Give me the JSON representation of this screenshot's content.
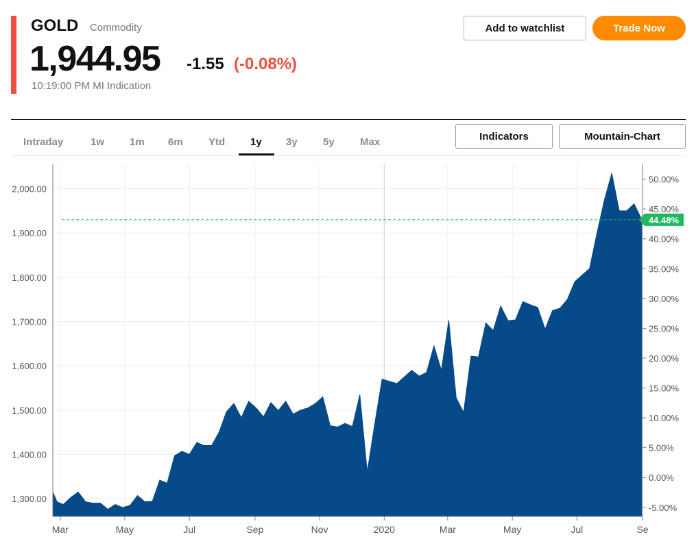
{
  "header": {
    "symbol": "GOLD",
    "asset_type": "Commodity",
    "price": "1,944.95",
    "change": "-1.55",
    "change_pct": "(-0.08%)",
    "timestamp": "10:19:00 PM MI Indication",
    "accent_color": "#f04e3e"
  },
  "actions": {
    "watchlist_label": "Add to watchlist",
    "trade_label": "Trade Now",
    "trade_color": "#ff8a00"
  },
  "tabs": [
    {
      "label": "Intraday",
      "active": false
    },
    {
      "label": "1w",
      "active": false
    },
    {
      "label": "1m",
      "active": false
    },
    {
      "label": "6m",
      "active": false
    },
    {
      "label": "Ytd",
      "active": false
    },
    {
      "label": "1y",
      "active": true
    },
    {
      "label": "3y",
      "active": false
    },
    {
      "label": "5y",
      "active": false
    },
    {
      "label": "Max",
      "active": false
    }
  ],
  "chart_controls": {
    "indicators_label": "Indicators",
    "chart_type_label": "Mountain-Chart"
  },
  "chart_data": {
    "type": "area",
    "fill_color": "#064a8a",
    "reference_color": "#1eb85d",
    "reference_value": 1930,
    "reference_label": "44.48%",
    "ylim": [
      1260,
      2055
    ],
    "y_ticks": [
      {
        "value": 1300,
        "label": "1,300.00"
      },
      {
        "value": 1400,
        "label": "1,400.00"
      },
      {
        "value": 1500,
        "label": "1,500.00"
      },
      {
        "value": 1600,
        "label": "1,600.00"
      },
      {
        "value": 1700,
        "label": "1,700.00"
      },
      {
        "value": 1800,
        "label": "1,800.00"
      },
      {
        "value": 1900,
        "label": "1,900.00"
      },
      {
        "value": 2000,
        "label": "2,000.00"
      }
    ],
    "y2_ticks": [
      {
        "value": 1280.4,
        "label": "-5.00%"
      },
      {
        "value": 1347.8,
        "label": "0.00%"
      },
      {
        "value": 1415.2,
        "label": "5.00%"
      },
      {
        "value": 1482.6,
        "label": "10.00%"
      },
      {
        "value": 1550.0,
        "label": "15.00%"
      },
      {
        "value": 1617.4,
        "label": "20.00%"
      },
      {
        "value": 1684.7,
        "label": "25.00%"
      },
      {
        "value": 1752.1,
        "label": "30.00%"
      },
      {
        "value": 1819.5,
        "label": "35.00%"
      },
      {
        "value": 1886.9,
        "label": "40.00%"
      },
      {
        "value": 1954.3,
        "label": "45.00%"
      },
      {
        "value": 2021.7,
        "label": "50.00%"
      }
    ],
    "x_ticks": [
      {
        "date": "2019-03-01",
        "label": "Mar"
      },
      {
        "date": "2019-05-01",
        "label": "May"
      },
      {
        "date": "2019-07-01",
        "label": "Jul"
      },
      {
        "date": "2019-09-01",
        "label": "Sep"
      },
      {
        "date": "2019-11-01",
        "label": "Nov"
      },
      {
        "date": "2020-01-01",
        "label": "2020"
      },
      {
        "date": "2020-03-01",
        "label": "Mar"
      },
      {
        "date": "2020-05-01",
        "label": "May"
      },
      {
        "date": "2020-07-01",
        "label": "Jul"
      },
      {
        "date": "2020-09-01",
        "label": "Se"
      }
    ],
    "x": [
      "2019-02-22",
      "2019-02-26",
      "2019-03-04",
      "2019-03-11",
      "2019-03-18",
      "2019-03-25",
      "2019-04-01",
      "2019-04-08",
      "2019-04-15",
      "2019-04-22",
      "2019-04-29",
      "2019-05-06",
      "2019-05-13",
      "2019-05-20",
      "2019-05-27",
      "2019-06-03",
      "2019-06-10",
      "2019-06-17",
      "2019-06-24",
      "2019-07-01",
      "2019-07-08",
      "2019-07-15",
      "2019-07-22",
      "2019-07-29",
      "2019-08-05",
      "2019-08-12",
      "2019-08-19",
      "2019-08-26",
      "2019-09-02",
      "2019-09-09",
      "2019-09-16",
      "2019-09-23",
      "2019-09-30",
      "2019-10-07",
      "2019-10-14",
      "2019-10-21",
      "2019-10-28",
      "2019-11-04",
      "2019-11-11",
      "2019-11-18",
      "2019-11-25",
      "2019-12-02",
      "2019-12-09",
      "2019-12-16",
      "2019-12-23",
      "2019-12-30",
      "2020-01-06",
      "2020-01-13",
      "2020-01-20",
      "2020-01-27",
      "2020-02-03",
      "2020-02-10",
      "2020-02-17",
      "2020-02-24",
      "2020-03-02",
      "2020-03-09",
      "2020-03-16",
      "2020-03-23",
      "2020-03-30",
      "2020-04-06",
      "2020-04-13",
      "2020-04-20",
      "2020-04-27",
      "2020-05-04",
      "2020-05-11",
      "2020-05-18",
      "2020-05-25",
      "2020-06-01",
      "2020-06-08",
      "2020-06-15",
      "2020-06-22",
      "2020-06-29",
      "2020-07-06",
      "2020-07-13",
      "2020-07-20",
      "2020-07-27",
      "2020-08-03",
      "2020-08-10",
      "2020-08-17",
      "2020-08-24",
      "2020-08-31"
    ],
    "values": [
      1315,
      1293,
      1287,
      1303,
      1315,
      1293,
      1290,
      1290,
      1276,
      1287,
      1280,
      1285,
      1307,
      1293,
      1294,
      1342,
      1335,
      1397,
      1407,
      1400,
      1427,
      1420,
      1420,
      1450,
      1496,
      1515,
      1483,
      1520,
      1505,
      1485,
      1517,
      1499,
      1520,
      1491,
      1500,
      1505,
      1515,
      1530,
      1465,
      1462,
      1470,
      1463,
      1535,
      1360,
      1468,
      1570,
      1565,
      1560,
      1575,
      1590,
      1577,
      1585,
      1645,
      1590,
      1703,
      1528,
      1495,
      1622,
      1620,
      1697,
      1680,
      1735,
      1702,
      1704,
      1745,
      1738,
      1732,
      1683,
      1725,
      1730,
      1750,
      1790,
      1805,
      1820,
      1900,
      1975,
      2035,
      1950,
      1950,
      1966,
      1932
    ]
  }
}
